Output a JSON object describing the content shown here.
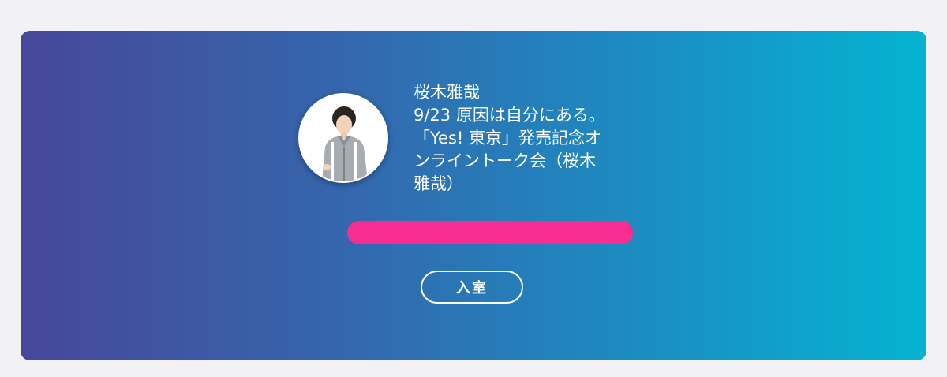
{
  "event": {
    "artist_name": "桜木雅哉",
    "title": "9/23 原因は自分にある。「Yes! 東京」発売記念オンライントーク会（桜木雅哉）",
    "title_lines": [
      "9/23 原因は自分にある。",
      "「Yes! 東京」発売記念オ",
      "ンライントーク会（桜木",
      "雅哉）"
    ],
    "enter_label": "入室"
  },
  "colors": {
    "gradient_start": "#47479a",
    "gradient_end": "#05b3d1",
    "redaction": "#f72d91",
    "text": "#ffffff"
  }
}
